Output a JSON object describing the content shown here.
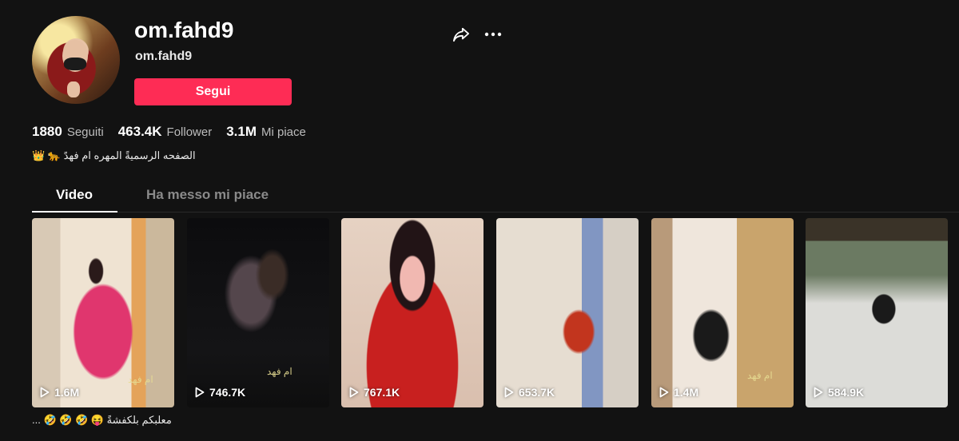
{
  "profile": {
    "username": "om.fahd9",
    "nickname": "om.fahd9",
    "follow_label": "Segui",
    "bio": "الصفحه الرسميةً المهره ام فهدً 🐆 👑"
  },
  "stats": [
    {
      "value": "1880",
      "label": "Seguiti"
    },
    {
      "value": "463.4K",
      "label": "Follower"
    },
    {
      "value": "3.1M",
      "label": "Mi piace"
    }
  ],
  "tabs": {
    "video": "Video",
    "liked": "Ha messo mi piace"
  },
  "videos": [
    {
      "views": "1.6M",
      "overlay": "ام فهد"
    },
    {
      "views": "746.7K",
      "overlay": "ام فهد"
    },
    {
      "views": "767.1K",
      "overlay": ""
    },
    {
      "views": "653.7K",
      "overlay": ""
    },
    {
      "views": "1.4M",
      "overlay": "ام فهد"
    },
    {
      "views": "584.9K",
      "overlay": ""
    }
  ],
  "first_caption": "معلبكم بلكفشةً 😝 🤣 🤣 🤣 ...",
  "colors": {
    "background": "#121212",
    "follow_button": "#fe2c55",
    "muted_text": "#8a8a8a"
  },
  "icons": [
    "share-icon",
    "more-icon",
    "play-icon"
  ]
}
